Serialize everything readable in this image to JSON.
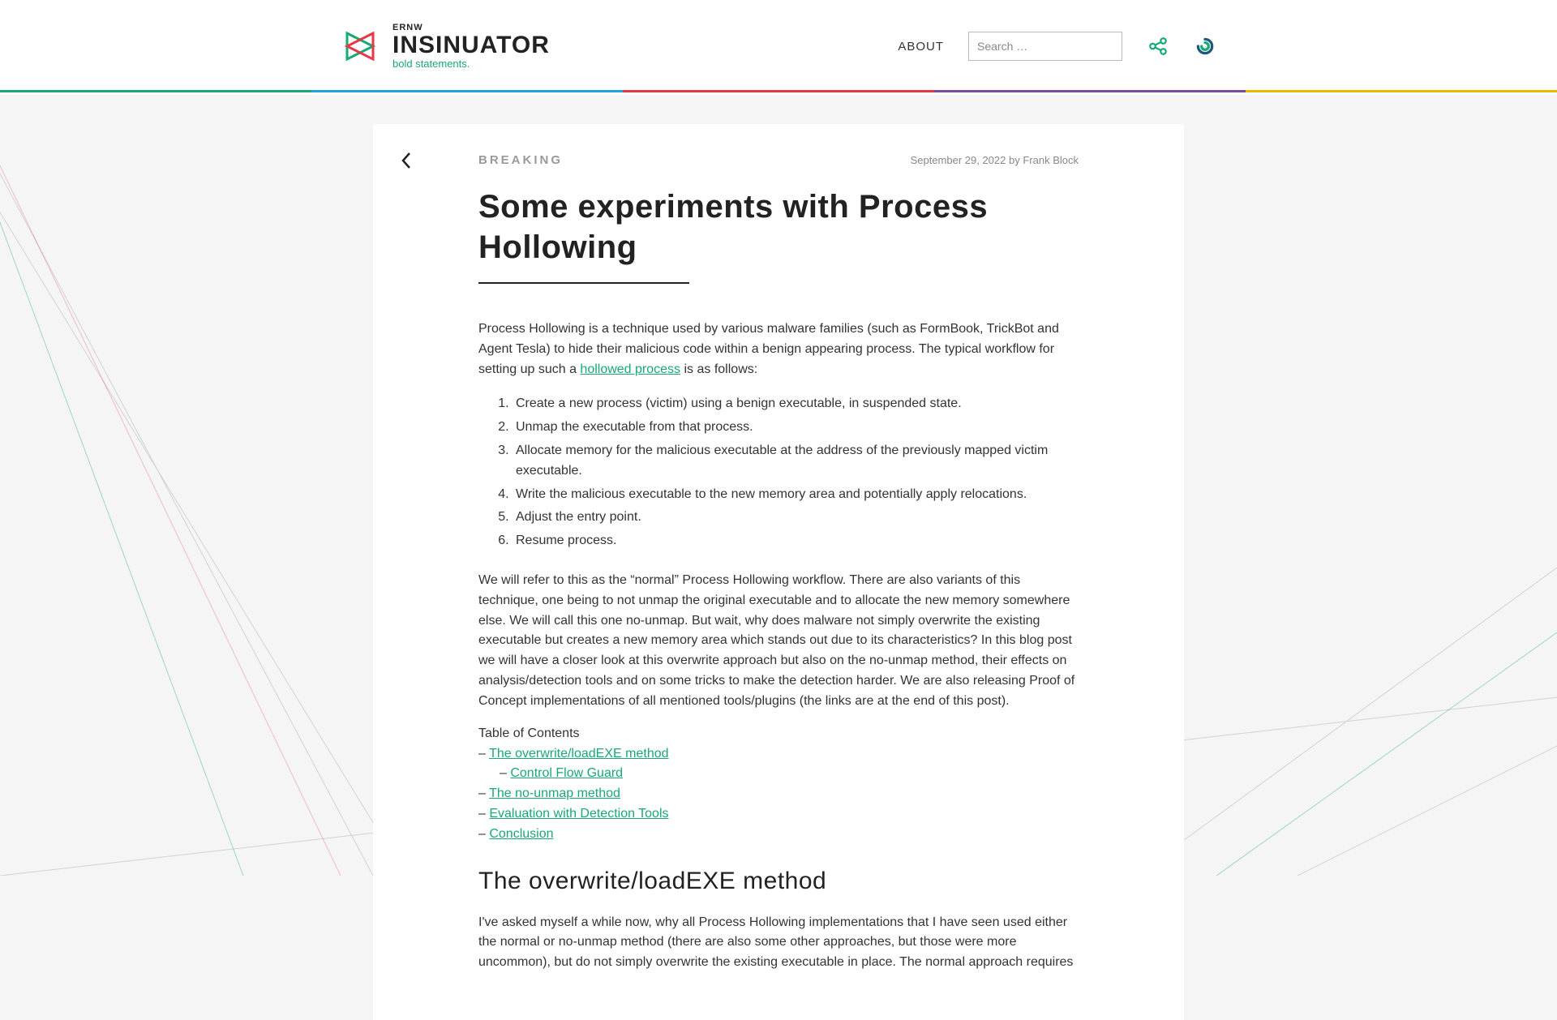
{
  "brand": {
    "super": "ERNW",
    "name": "INSINUATOR",
    "tag": "bold statements."
  },
  "nav": {
    "about": "ABOUT",
    "search_placeholder": "Search …"
  },
  "stripe_colors": [
    "#19a974",
    "#1ba6e0",
    "#e63946",
    "#7b4ba3",
    "#e6b800"
  ],
  "article": {
    "category": "BREAKING",
    "date": "September 29, 2022",
    "byline_prefix": "by",
    "author": "Frank Block",
    "title": "Some experiments with Process Hollowing",
    "intro_a": "Process Hollowing is a technique used by various malware families (such as FormBook, TrickBot and Agent Tesla) to hide their malicious code within a benign appearing process. The typical workflow for setting up such a ",
    "intro_link": "hollowed process",
    "intro_b": " is as follows:",
    "steps": [
      "Create a new process (victim) using a benign executable, in suspended state.",
      "Unmap the executable from that process.",
      "Allocate memory for the malicious executable at the address of the previously mapped victim executable.",
      "Write the malicious executable to the new memory area and potentially apply relocations.",
      "Adjust the entry point.",
      "Resume process."
    ],
    "para2": "We will refer to this as the “normal” Process Hollowing workflow. There are also variants of this technique, one being to not unmap the original executable and to allocate the new memory somewhere else. We will call this one no-unmap. But wait, why does malware not simply overwrite the existing executable but creates a new memory area which stands out due to its characteristics? In this blog post we will have a closer look at this overwrite approach but also on the no-unmap method, their effects on analysis/detection tools and on some tricks to make the detection harder. We are also releasing Proof of Concept implementations of all mentioned tools/plugins (the links are at the end of this post).",
    "toc_heading": "Table of Contents",
    "toc": [
      {
        "label": "The overwrite/loadEXE method",
        "indent": false
      },
      {
        "label": "Control Flow Guard",
        "indent": true
      },
      {
        "label": "The no-unmap method",
        "indent": false
      },
      {
        "label": "Evaluation with Detection Tools",
        "indent": false
      },
      {
        "label": "Conclusion",
        "indent": false
      }
    ],
    "section_heading": "The overwrite/loadEXE method",
    "section_body": "I've asked myself a while now, why all Process Hollowing implementations that I have seen used either the normal or no-unmap method (there are also some other approaches, but those were more uncommon), but do not simply overwrite the existing executable in place. The normal approach requires"
  }
}
